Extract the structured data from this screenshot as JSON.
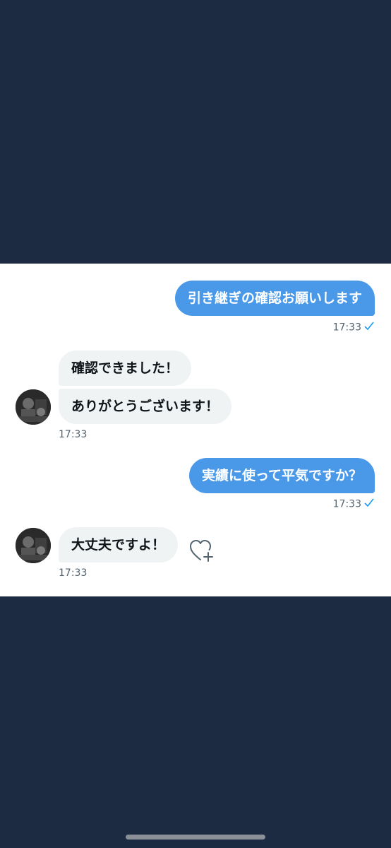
{
  "messages": [
    {
      "direction": "out",
      "text": "引き継ぎの確認お願いします",
      "time": "17:33"
    },
    {
      "direction": "in",
      "text": "確認できました！"
    },
    {
      "direction": "in",
      "text": "ありがとうございます！",
      "time": "17:33"
    },
    {
      "direction": "out",
      "text": "実績に使って平気ですか？",
      "time": "17:33"
    },
    {
      "direction": "in",
      "text": "大丈夫ですよ！",
      "time": "17:33"
    }
  ],
  "icons": {
    "read_receipt": "checkmark-icon",
    "react": "heart-plus-icon",
    "avatar": "user-avatar"
  },
  "colors": {
    "background": "#1c2a42",
    "outgoing_bubble": "#4a99e9",
    "incoming_bubble": "#eff3f4",
    "accent": "#1d9bf0"
  }
}
